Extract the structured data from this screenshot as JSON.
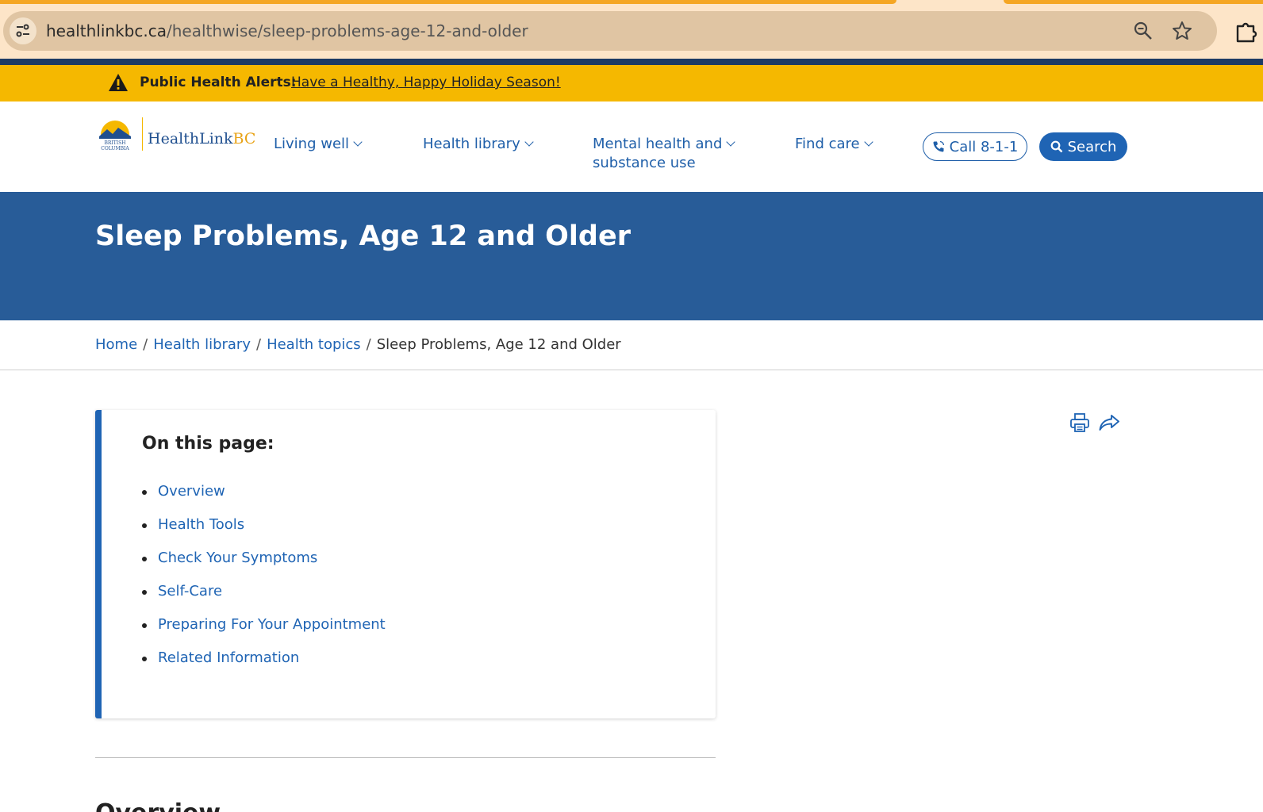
{
  "browser": {
    "url_domain": "healthlinkbc.ca",
    "url_path": "/healthwise/sleep-problems-age-12-and-older"
  },
  "alert": {
    "label": "Public Health Alerts:",
    "link_text": "Have a Healthy, Happy Holiday Season!"
  },
  "header": {
    "logo_text_health": "HealthLink",
    "logo_text_bc": "BC",
    "nav": [
      {
        "label": "Living well"
      },
      {
        "label": "Health library"
      },
      {
        "label_line1": "Mental health and",
        "label_line2": "substance use"
      },
      {
        "label": "Find care"
      }
    ],
    "call_label": "Call 8-1-1",
    "search_label": "Search"
  },
  "banner": {
    "title": "Sleep Problems, Age 12 and Older"
  },
  "breadcrumb": {
    "items": [
      "Home",
      "Health library",
      "Health topics"
    ],
    "current": "Sleep Problems, Age 12 and Older"
  },
  "toc": {
    "heading": "On this page:",
    "items": [
      "Overview",
      "Health Tools",
      "Check Your Symptoms",
      "Self-Care",
      "Preparing For Your Appointment",
      "Related Information"
    ]
  },
  "main": {
    "section_heading": "Overview"
  },
  "colors": {
    "brand_blue": "#285c98",
    "link_blue": "#1f64b4",
    "alert_yellow": "#f5b800"
  }
}
